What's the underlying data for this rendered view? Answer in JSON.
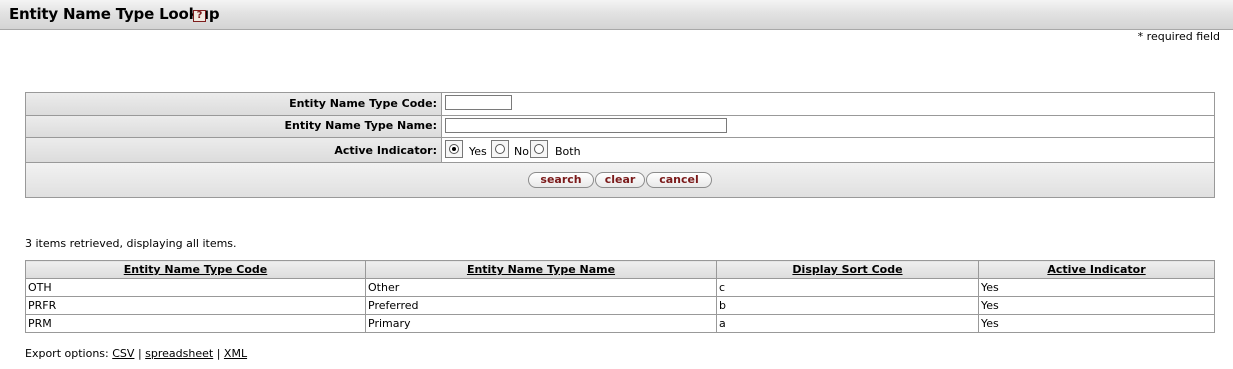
{
  "header": {
    "title": "Entity Name Type Lookup",
    "help_glyph": "?"
  },
  "required_note": "* required field",
  "criteria": {
    "code_label": "Entity Name Type Code:",
    "code_value": "",
    "name_label": "Entity Name Type Name:",
    "name_value": "",
    "active_label": "Active Indicator:",
    "options": [
      "Yes",
      "No",
      "Both"
    ],
    "selected": "Yes"
  },
  "buttons": {
    "search": "search",
    "clear": "clear",
    "cancel": "cancel"
  },
  "results": {
    "count_text": "3 items retrieved, displaying all items.",
    "columns": [
      "Entity Name Type Code",
      "Entity Name Type Name",
      "Display Sort Code",
      "Active Indicator"
    ],
    "rows": [
      [
        "OTH",
        "Other",
        "c",
        "Yes"
      ],
      [
        "PRFR",
        "Preferred",
        "b",
        "Yes"
      ],
      [
        "PRM",
        "Primary",
        "a",
        "Yes"
      ]
    ]
  },
  "export": {
    "label": "Export options:",
    "csv": "CSV",
    "spreadsheet": "spreadsheet",
    "xml": "XML",
    "sep": "|"
  }
}
